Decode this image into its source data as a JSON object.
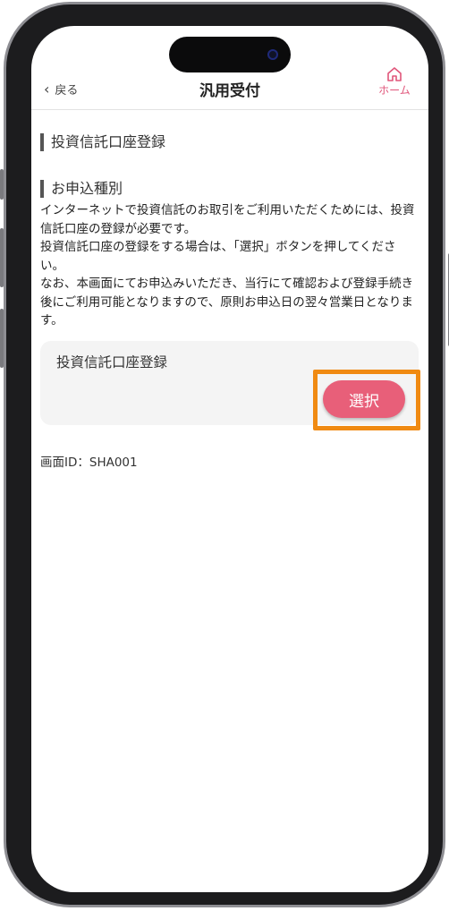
{
  "nav": {
    "back_label": "戻る",
    "back_chevron": "‹",
    "title": "汎用受付",
    "home_label": "ホーム"
  },
  "sections": {
    "main_title": "投資信託口座登録",
    "application_type_title": "お申込種別"
  },
  "description": "インターネットで投資信託のお取引をご利用いただくためには、投資信託口座の登録が必要です。\n投資信託口座の登録をする場合は、「選択」ボタンを押してください。\nなお、本画面にてお申込みいただき、当行にて確認および登録手続き後にご利用可能となりますので、原則お申込日の翌々営業日となります。",
  "card": {
    "title": "投資信託口座登録",
    "select_button": "選択"
  },
  "screen_id": "画面ID：SHA001",
  "colors": {
    "accent": "#e85f79",
    "highlight": "#f08a12",
    "home_icon": "#e0557a"
  },
  "icons": {
    "back": "chevron-left-icon",
    "home": "home-icon"
  }
}
